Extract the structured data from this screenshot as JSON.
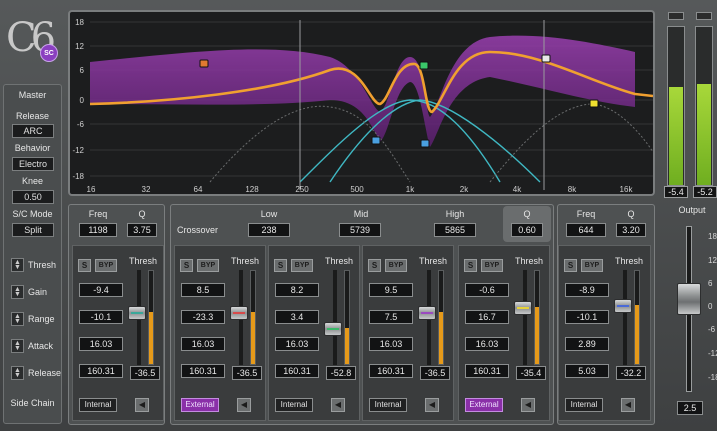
{
  "logo": {
    "text": "C6",
    "badge": "SC"
  },
  "master": {
    "title": "Master",
    "release_label": "Release",
    "release_value": "ARC",
    "behavior_label": "Behavior",
    "behavior_value": "Electro",
    "knee_label": "Knee",
    "knee_value": "0.50",
    "scmode_label": "S/C Mode",
    "scmode_value": "Split",
    "rows": [
      "Thresh",
      "Gain",
      "Range",
      "Attack",
      "Release"
    ],
    "sidechain_label": "Side Chain"
  },
  "graph": {
    "y_ticks": [
      "18",
      "12",
      "6",
      "0",
      "-6",
      "-12",
      "-18"
    ],
    "x_ticks": [
      "16",
      "32",
      "64",
      "128",
      "250",
      "500",
      "1k",
      "2k",
      "4k",
      "8k",
      "16k"
    ]
  },
  "meters": {
    "left_value": "-5.4",
    "right_value": "-5.2"
  },
  "colors": {
    "accent": "#e69a1a",
    "purple": "#8a2fa8",
    "graph_fill": "#7b2a8f",
    "curve": "#f0a030",
    "cyan": "#3fb7c2"
  },
  "crossover": {
    "label": "Crossover",
    "low_label": "Low",
    "low_value": "238",
    "mid_label": "Mid",
    "mid_value": "5739",
    "high_label": "High",
    "high_value": "5865",
    "q_label": "Q",
    "q_value": "0.60"
  },
  "left_band": {
    "freq_label": "Freq",
    "q_label": "Q",
    "freq_value": "1198",
    "q_value": "3.75"
  },
  "right_band": {
    "freq_label": "Freq",
    "q_label": "Q",
    "freq_value": "644",
    "q_value": "3.20"
  },
  "output": {
    "label": "Output",
    "value": "2.5",
    "ticks": [
      "18",
      "12",
      "6",
      "0",
      "-6",
      "-12",
      "-18"
    ]
  },
  "bands": [
    {
      "solo": "S",
      "bypass": "BYP",
      "thresh_label": "Thresh",
      "thresh": "-36.5",
      "values": [
        "-9.4",
        "-10.1",
        "16.03",
        "160.31"
      ],
      "sidechain": "Internal",
      "fill": 0.55,
      "knob_color": "#3aa89a"
    },
    {
      "solo": "S",
      "bypass": "BYP",
      "thresh_label": "Thresh",
      "thresh": "-36.5",
      "values": [
        "8.5",
        "-23.3",
        "16.03",
        "160.31"
      ],
      "sidechain": "External",
      "fill": 0.55,
      "knob_color": "#d84a4a"
    },
    {
      "solo": "S",
      "bypass": "BYP",
      "thresh_label": "Thresh",
      "thresh": "-52.8",
      "values": [
        "8.2",
        "3.4",
        "16.03",
        "160.31"
      ],
      "sidechain": "Internal",
      "fill": 0.38,
      "knob_color": "#3ab86a"
    },
    {
      "solo": "S",
      "bypass": "BYP",
      "thresh_label": "Thresh",
      "thresh": "-36.5",
      "values": [
        "9.5",
        "7.5",
        "16.03",
        "160.31"
      ],
      "sidechain": "Internal",
      "fill": 0.55,
      "knob_color": "#9a4ac0"
    },
    {
      "solo": "S",
      "bypass": "BYP",
      "thresh_label": "Thresh",
      "thresh": "-35.4",
      "values": [
        "-0.6",
        "16.7",
        "16.03",
        "160.31"
      ],
      "sidechain": "External",
      "fill": 0.6,
      "knob_color": "#e6d23a"
    },
    {
      "solo": "S",
      "bypass": "BYP",
      "thresh_label": "Thresh",
      "thresh": "-32.2",
      "values": [
        "-8.9",
        "-10.1",
        "2.89",
        "5.03"
      ],
      "sidechain": "Internal",
      "fill": 0.62,
      "knob_color": "#4a6ad8"
    }
  ]
}
